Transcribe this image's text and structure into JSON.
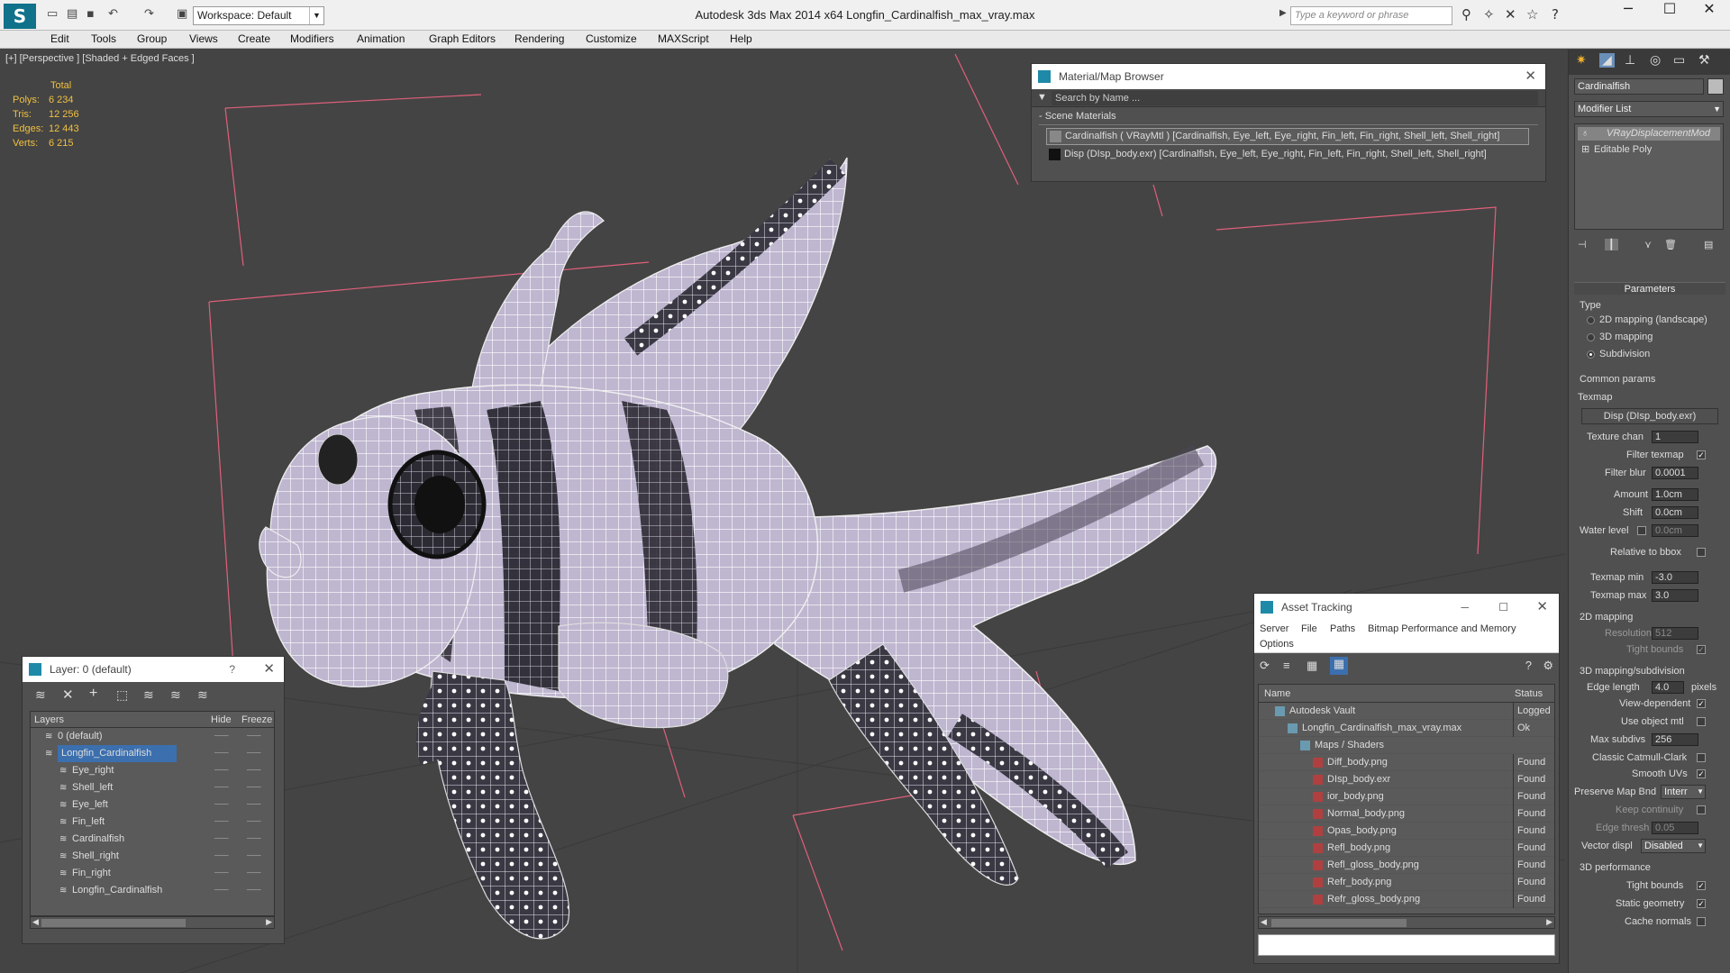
{
  "app": {
    "title": "Autodesk 3ds Max  2014 x64     Longfin_Cardinalfish_max_vray.max",
    "workspace": "Workspace: Default",
    "search_placeholder": "Type a keyword or phrase"
  },
  "menu": [
    "Edit",
    "Tools",
    "Group",
    "Views",
    "Create",
    "Modifiers",
    "Animation",
    "Graph Editors",
    "Rendering",
    "Customize",
    "MAXScript",
    "Help"
  ],
  "viewport": {
    "label": "[+] [Perspective ] [Shaded + Edged Faces ]",
    "stats": {
      "header": "Total",
      "rows": [
        {
          "k": "Polys:",
          "v": "6 234"
        },
        {
          "k": "Tris:",
          "v": "12 256"
        },
        {
          "k": "Edges:",
          "v": "12 443"
        },
        {
          "k": "Verts:",
          "v": "6 215"
        }
      ]
    }
  },
  "material_browser": {
    "title": "Material/Map Browser",
    "search": "Search by Name ...",
    "section": "- Scene Materials",
    "items": [
      "Cardinalfish  ( VRayMtl ) [Cardinalfish, Eye_left, Eye_right, Fin_left, Fin_right, Shell_left, Shell_right]",
      "Disp (DIsp_body.exr) [Cardinalfish, Eye_left, Eye_right, Fin_left, Fin_right, Shell_left, Shell_right]"
    ]
  },
  "layer_panel": {
    "title": "Layer: 0 (default)",
    "help": "?",
    "columns": [
      "Layers",
      "Hide",
      "Freeze"
    ],
    "rows": [
      {
        "name": "0 (default)",
        "indent": 1
      },
      {
        "name": "Longfin_Cardinalfish",
        "indent": 1,
        "selected": true
      },
      {
        "name": "Eye_right",
        "indent": 2
      },
      {
        "name": "Shell_left",
        "indent": 2
      },
      {
        "name": "Eye_left",
        "indent": 2
      },
      {
        "name": "Fin_left",
        "indent": 2
      },
      {
        "name": "Cardinalfish",
        "indent": 2
      },
      {
        "name": "Shell_right",
        "indent": 2
      },
      {
        "name": "Fin_right",
        "indent": 2
      },
      {
        "name": "Longfin_Cardinalfish",
        "indent": 2
      }
    ]
  },
  "asset_tracking": {
    "title": "Asset Tracking",
    "menu": [
      "Server",
      "File",
      "Paths",
      "Bitmap Performance and Memory",
      "Options"
    ],
    "columns": [
      "Name",
      "Status"
    ],
    "rows": [
      {
        "name": "Autodesk Vault",
        "status": "Logged",
        "indent": 1
      },
      {
        "name": "Longfin_Cardinalfish_max_vray.max",
        "status": "Ok",
        "indent": 2
      },
      {
        "name": "Maps / Shaders",
        "status": "",
        "indent": 3
      },
      {
        "name": "Diff_body.png",
        "status": "Found",
        "indent": 4
      },
      {
        "name": "DIsp_body.exr",
        "status": "Found",
        "indent": 4
      },
      {
        "name": "ior_body.png",
        "status": "Found",
        "indent": 4
      },
      {
        "name": "Normal_body.png",
        "status": "Found",
        "indent": 4
      },
      {
        "name": "Opas_body.png",
        "status": "Found",
        "indent": 4
      },
      {
        "name": "Refl_body.png",
        "status": "Found",
        "indent": 4
      },
      {
        "name": "Refl_gloss_body.png",
        "status": "Found",
        "indent": 4
      },
      {
        "name": "Refr_body.png",
        "status": "Found",
        "indent": 4
      },
      {
        "name": "Refr_gloss_body.png",
        "status": "Found",
        "indent": 4
      }
    ]
  },
  "command_panel": {
    "object_name": "Cardinalfish",
    "modifier_list": "Modifier List",
    "stack": [
      "VRayDisplacementMod",
      "Editable Poly"
    ],
    "parameters": "Parameters",
    "type_label": "Type",
    "type_options": [
      "2D mapping (landscape)",
      "3D mapping",
      "Subdivision"
    ],
    "common_params": "Common params",
    "texmap_label": "Texmap",
    "texmap_value": "Disp (DIsp_body.exr)",
    "texture_chan": {
      "label": "Texture chan",
      "value": "1"
    },
    "filter_texmap": "Filter texmap",
    "filter_blur": {
      "label": "Filter blur",
      "value": "0.0001"
    },
    "amount": {
      "label": "Amount",
      "value": "1.0cm"
    },
    "shift": {
      "label": "Shift",
      "value": "0.0cm"
    },
    "water_level": {
      "label": "Water level",
      "value": "0.0cm"
    },
    "relative_bbox": "Relative to bbox",
    "texmap_min": {
      "label": "Texmap min",
      "value": "-3.0"
    },
    "texmap_max": {
      "label": "Texmap max",
      "value": "3.0"
    },
    "mapping_2d": "2D mapping",
    "resolution": {
      "label": "Resolution",
      "value": "512"
    },
    "tight_bounds": "Tight bounds",
    "mapping_3d": "3D mapping/subdivision",
    "edge_length": {
      "label": "Edge length",
      "value": "4.0",
      "unit": "pixels"
    },
    "view_dependent": "View-dependent",
    "use_object_mtl": "Use object mtl",
    "max_subdivs": {
      "label": "Max subdivs",
      "value": "256"
    },
    "classic_cc": "Classic Catmull-Clark",
    "smooth_uvs": "Smooth UVs",
    "preserve_map": {
      "label": "Preserve Map Bnd",
      "value": "Interr"
    },
    "keep_continuity": "Keep continuity",
    "edge_thresh": {
      "label": "Edge thresh",
      "value": "0.05"
    },
    "vector_displ": {
      "label": "Vector displ",
      "value": "Disabled"
    },
    "performance": "3D performance",
    "perf_tight": "Tight bounds",
    "static_geometry": "Static geometry",
    "cache_normals": "Cache normals"
  }
}
